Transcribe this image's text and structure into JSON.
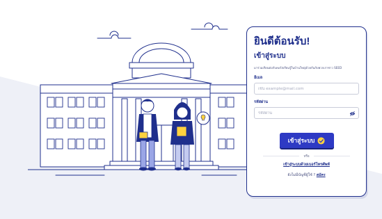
{
  "colors": {
    "brand": "#1f2f8c",
    "button": "#2e3ac4",
    "accent_yellow": "#ffd23f",
    "background_shape": "#eef0f7"
  },
  "login_card": {
    "welcome": "ยินดีต้อนรับ!",
    "title": "เข้าสู่ระบบ",
    "subtitle": "มาร่วมเรียนต่อกับคอร์สเรียนรู้ในบ้านใหญ่ด้วยกันกับพวกเราชาว SEED",
    "email": {
      "label": "อีเมล",
      "placeholder": "เช่น example@mail.com",
      "value": ""
    },
    "password": {
      "label": "รหัสผ่าน",
      "placeholder": "รหัสผ่าน",
      "value": "",
      "toggle_icon": "eye-slash-icon"
    },
    "login_button": "เข้าสู่ระบบ",
    "login_button_icon": "yellow-badge-icon",
    "or_text": "หรือ",
    "phone_login_link": "เข้าสู่ระบบด้วยเบอร์โทรศัพท์",
    "no_account_text": "ยังไม่มีบัญชีผู้ใช้ ?",
    "signup_link": "สมัคร"
  },
  "illustration": {
    "description_icon": "university-building-with-two-students-icon"
  }
}
